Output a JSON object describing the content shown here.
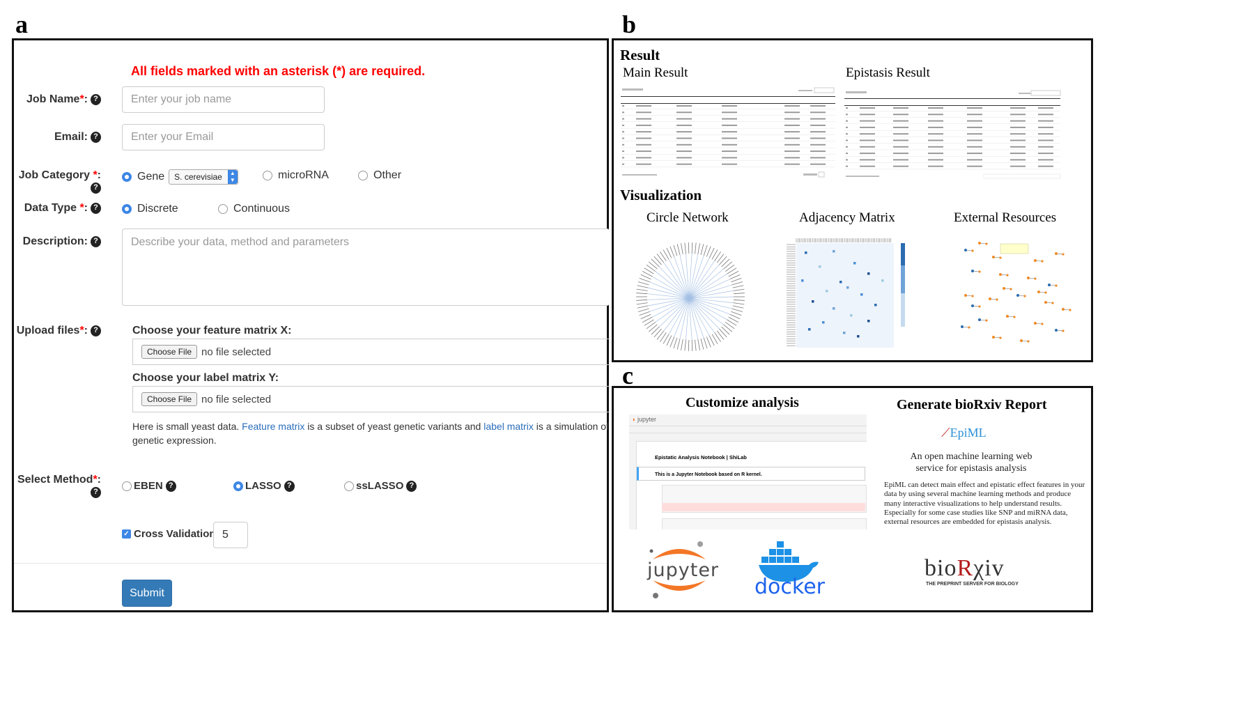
{
  "panel_letters": {
    "a": "a",
    "b": "b",
    "c": "c"
  },
  "form": {
    "required_note": "All fields marked with an asterisk (*) are required.",
    "job_name": {
      "label": "Job Name",
      "star": "*",
      "colon": ":",
      "placeholder": "Enter your job name"
    },
    "email": {
      "label": "Email:",
      "placeholder": "Enter your Email"
    },
    "job_category": {
      "label": "Job Category ",
      "star": "*",
      "colon": ":",
      "options": [
        "Gene",
        "microRNA",
        "Other"
      ],
      "selected": "Gene",
      "species_select": "S. cerevisiae"
    },
    "data_type": {
      "label": "Data Type ",
      "star": "*",
      "colon": ":",
      "options": [
        "Discrete",
        "Continuous"
      ],
      "selected": "Discrete"
    },
    "description": {
      "label": "Description:",
      "placeholder": "Describe your data, method and parameters"
    },
    "upload": {
      "label": "Upload files",
      "star": "*",
      "colon": ":",
      "feature_heading": "Choose your feature matrix X:",
      "label_heading": "Choose your label matrix Y:",
      "choose_file": "Choose File",
      "no_file": "no file selected",
      "note_1": "Here is small yeast data. ",
      "link_feature": "Feature matrix",
      "note_2": " is a subset of yeast genetic variants and ",
      "link_label": "label matrix",
      "note_3": " is a simulation of genetic expression."
    },
    "method": {
      "label": "Select Method",
      "star": "*",
      "colon": ":",
      "options": [
        "EBEN",
        "LASSO",
        "ssLASSO"
      ],
      "selected": "LASSO"
    },
    "cross_validation": {
      "label": "Cross Validation:",
      "checked": true,
      "value": "5"
    },
    "submit": "Submit",
    "help_icon": "?"
  },
  "panel_b": {
    "result_heading": "Result",
    "main_result": "Main Result",
    "epistasis_result": "Epistasis Result",
    "visualization_heading": "Visualization",
    "circle_network": "Circle Network",
    "adjacency_matrix": "Adjacency Matrix",
    "external_resources": "External Resources"
  },
  "panel_c": {
    "customize_heading": "Customize analysis",
    "report_heading": "Generate bioRxiv Report",
    "notebook_title": "Epistatic Analysis Notebook | ShiLab",
    "notebook_note": "This is a Jupyter Notebook based on R kernel.",
    "jupyter_header": "jupyter",
    "epiml_logo": "EpiML",
    "tagline": "An open machine learning web service for epistasis analysis",
    "description": "EpiML can detect main effect and epistatic effect features in your data by using several machine learning methods and produce many interactive visualizations to help understand results. Especially for some case studies like SNP and miRNA data, external resources are embedded for epistasis analysis.",
    "logo_jupyter": "jupyter",
    "logo_docker": "docker",
    "logo_biorxiv_pre": "bio",
    "logo_biorxiv_r": "R",
    "logo_biorxiv_post": "χiv",
    "logo_biorxiv_sub": "THE PREPRINT SERVER FOR BIOLOGY"
  },
  "colors": {
    "accent": "#3d87e6",
    "required": "#ff0000",
    "submit": "#337ab7",
    "link": "#2a6ebb"
  }
}
